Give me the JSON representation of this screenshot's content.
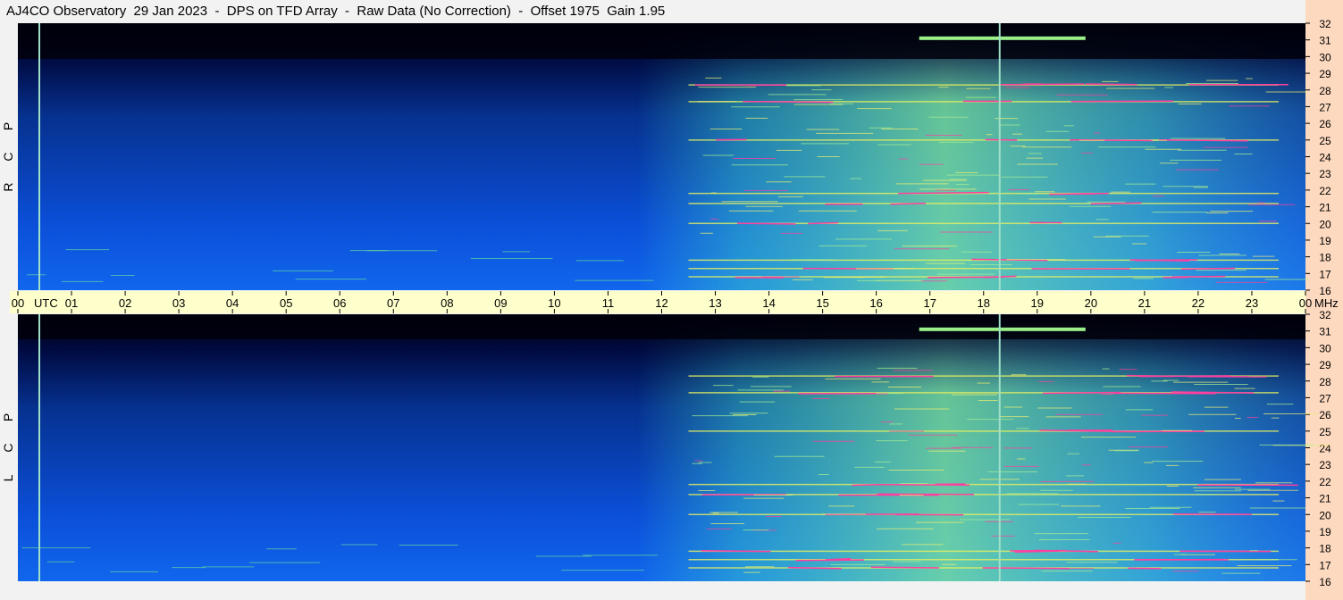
{
  "header": {
    "title": "AJ4CO Observatory  29 Jan 2023  -  DPS on TFD Array  -  Raw Data (No Correction)  -  Offset 1975  Gain 1.95"
  },
  "colors": {
    "page_bg": "#f2f2f2",
    "time_axis_band": "#ffffcc",
    "freq_axis_band": "#fcd9bf",
    "spectrogram_low": "#000000",
    "spectrogram_mid": "#0a4fd6",
    "spectrogram_high": "#9cf08a",
    "spectrogram_peak": "#ff3fa0",
    "marker_line": "#9fe0c8"
  },
  "chart_data": {
    "type": "heatmap",
    "title": "AJ4CO Observatory  29 Jan 2023  -  DPS on TFD Array  -  Raw Data (No Correction)  -  Offset 1975  Gain 1.95",
    "x_axis": {
      "unit": "UTC",
      "ticks": [
        "00",
        "01",
        "02",
        "03",
        "04",
        "05",
        "06",
        "07",
        "08",
        "09",
        "10",
        "11",
        "12",
        "13",
        "14",
        "15",
        "16",
        "17",
        "18",
        "19",
        "20",
        "21",
        "22",
        "23",
        "00"
      ],
      "range_hours": [
        0,
        24
      ]
    },
    "y_axis": {
      "unit": "MHz",
      "ticks": [
        "32",
        "31",
        "30",
        "29",
        "28",
        "27",
        "26",
        "25",
        "24",
        "23",
        "22",
        "21",
        "20",
        "19",
        "18",
        "17",
        "16"
      ],
      "range_mhz": [
        16,
        32
      ]
    },
    "panels": [
      {
        "name": "R C P",
        "letters": [
          "R",
          "C",
          "P"
        ]
      },
      {
        "name": "L C P",
        "letters": [
          "L",
          "C",
          "P"
        ]
      }
    ],
    "intensity_profile": {
      "bright_period_utc": [
        12.5,
        23.5
      ],
      "peak_hour_utc": 17.5,
      "vertical_marker_utc": [
        0.4,
        18.3
      ],
      "persistent_bands_mhz": [
        31.1,
        28.3,
        27.3,
        25.0,
        21.8,
        21.2,
        20.0,
        17.8,
        17.3,
        16.8
      ]
    }
  }
}
